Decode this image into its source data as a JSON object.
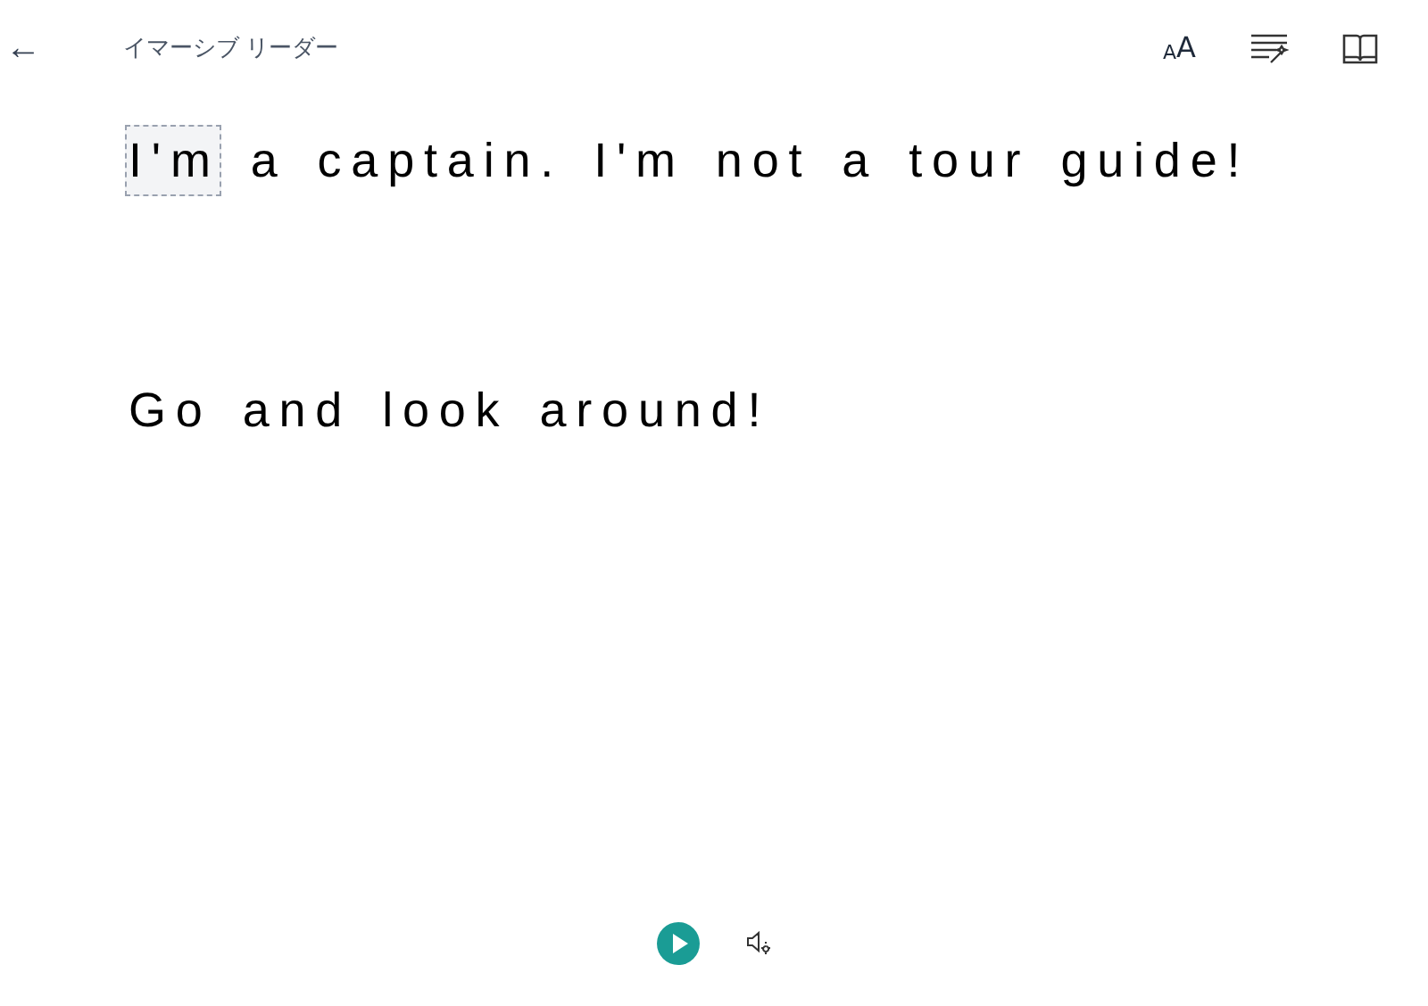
{
  "header": {
    "back": "←",
    "title": "イマーシブ リーダー",
    "text_size": {
      "small": "A",
      "large": "A"
    }
  },
  "paragraphs": [
    {
      "words": [
        {
          "text": "I'm",
          "selected": true
        },
        {
          "text": "a",
          "selected": false
        },
        {
          "text": "captain.",
          "selected": false
        },
        {
          "text": "I'm",
          "selected": false
        },
        {
          "text": "not",
          "selected": false
        },
        {
          "text": "a",
          "selected": false
        },
        {
          "text": "tour",
          "selected": false
        },
        {
          "text": "guide!",
          "selected": false
        }
      ]
    },
    {
      "words": [
        {
          "text": "Go",
          "selected": false
        },
        {
          "text": "and",
          "selected": false
        },
        {
          "text": "look",
          "selected": false
        },
        {
          "text": "around!",
          "selected": false
        }
      ]
    }
  ]
}
